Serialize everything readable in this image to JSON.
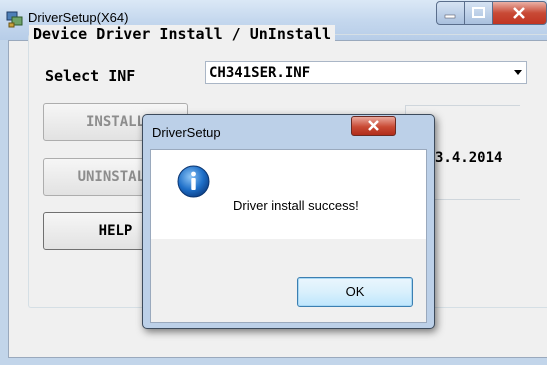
{
  "main_window": {
    "title": "DriverSetup(X64)",
    "group_title": "Device Driver Install / UnInstall",
    "select_inf_label": "Select INF",
    "inf_value": "CH341SER.INF",
    "buttons": {
      "install": "INSTALL",
      "uninstall": "UNINSTALL",
      "help": "HELP"
    },
    "driver_date": "3.4.2014",
    "icons": {
      "app": "driver-setup-icon",
      "minimize": "minimize-icon",
      "maximize": "maximize-icon",
      "close": "close-icon"
    }
  },
  "dialog": {
    "title": "DriverSetup",
    "message": "Driver install success!",
    "ok_label": "OK",
    "icons": {
      "info": "info-icon",
      "close": "close-icon"
    }
  },
  "colors": {
    "titlebar": "#c5d8ee",
    "close_button": "#c84a36",
    "info_icon": "#1e6fc8"
  }
}
